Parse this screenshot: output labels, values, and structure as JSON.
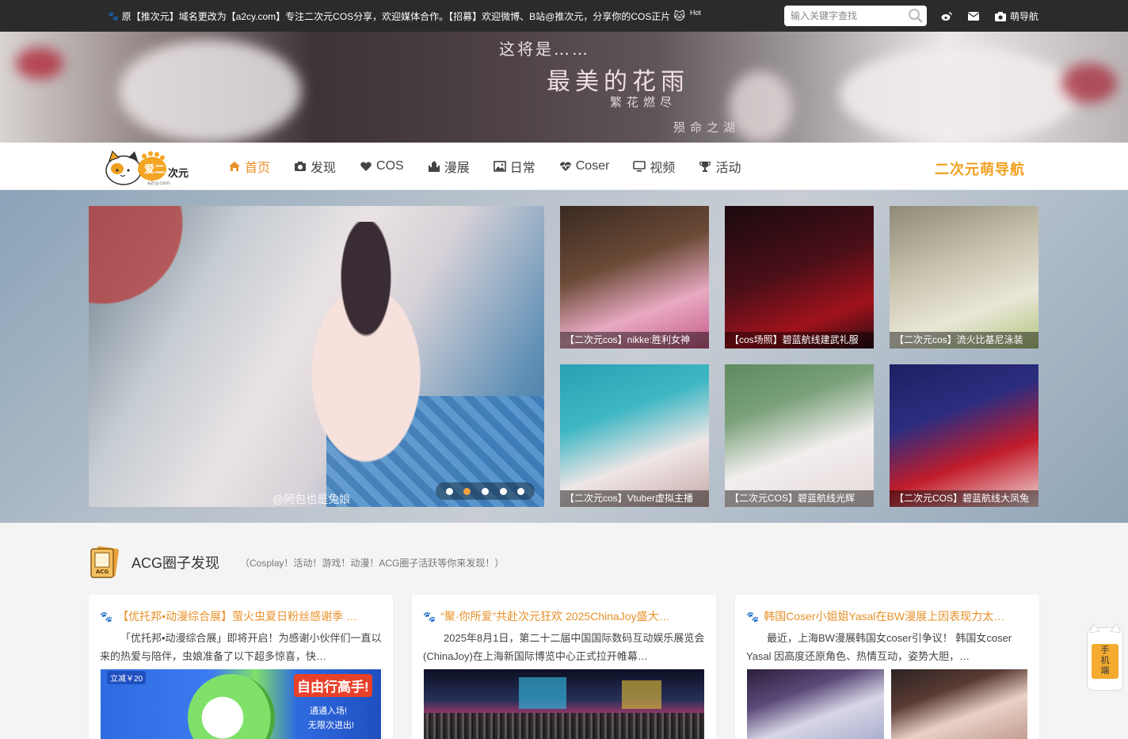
{
  "topbar": {
    "notice": "原【推次元】域名更改为【a2cy.com】专注二次元COS分享，欢迎媒体合作。【招募】欢迎微博、B站@推次元，分享你的COS正片",
    "hot_badge": "Hot",
    "search_placeholder": "输入关键字查找",
    "nav_link": "萌导航",
    "icons": [
      "weibo-icon",
      "mail-icon",
      "camera-icon"
    ]
  },
  "banner": {
    "line1": "这将是……",
    "line2": "最美的花雨",
    "line3": "繁花燃尽",
    "line4": "殒命之湖"
  },
  "nav": {
    "logo_text": "爱二次元",
    "items": [
      {
        "label": "首页",
        "icon": "home-icon",
        "active": true
      },
      {
        "label": "发现",
        "icon": "camera-icon",
        "active": false
      },
      {
        "label": "COS",
        "icon": "heart-icon",
        "active": false
      },
      {
        "label": "漫展",
        "icon": "castle-icon",
        "active": false
      },
      {
        "label": "日常",
        "icon": "image-icon",
        "active": false
      },
      {
        "label": "Coser",
        "icon": "heartbeat-icon",
        "active": false
      },
      {
        "label": "视频",
        "icon": "monitor-icon",
        "active": false
      },
      {
        "label": "活动",
        "icon": "trophy-icon",
        "active": false
      }
    ],
    "right_link": "二次元萌导航"
  },
  "slider": {
    "watermark": "@阿包也是兔娘",
    "dots": 5,
    "active_dot": 1
  },
  "thumbs": [
    {
      "caption": "【二次元cos】nikke:胜利女神",
      "colors": [
        "#3a2a22",
        "#e8a9c2"
      ]
    },
    {
      "caption": "【cos场照】碧蓝航线建武礼服",
      "colors": [
        "#2a0d12",
        "#a0121c"
      ]
    },
    {
      "caption": "【二次元cos】流火比基尼泳装",
      "colors": [
        "#c9c2ad",
        "#e9e6d8"
      ]
    },
    {
      "caption": "【二次元cos】Vtuber虚拟主播",
      "colors": [
        "#3fb7c4",
        "#efe6e6"
      ]
    },
    {
      "caption": "【二次元COS】碧蓝航线光辉",
      "colors": [
        "#7aa17a",
        "#f2eeee"
      ]
    },
    {
      "caption": "【二次元COS】碧蓝航线大凤兔",
      "colors": [
        "#1f1f63",
        "#c11c2a"
      ]
    }
  ],
  "section": {
    "title": "ACG圈子发现",
    "subtitle": "（Cosplay！活动！游戏！动漫！ACG圈子活跃等你来发现！）",
    "icon_label": "ACG"
  },
  "cards": [
    {
      "title": "【优托邦•动漫综合展】萤火虫夏日粉丝感谢季 …",
      "desc": "「优托邦•动漫综合展」即将开启！为感谢小伙伴们一直以来的热爱与陪伴，虫娘准备了以下超多惊喜，快…",
      "img_text_1": "立减￥20",
      "img_text_2": "自由行高手!",
      "img_text_3": "通通入场!",
      "img_text_4": "无限次进出!"
    },
    {
      "title": "“聚·你所爱”共赴次元狂欢 2025ChinaJoy盛大…",
      "desc": "2025年8月1日，第二十二届中国国际数码互动娱乐展览会(ChinaJoy)在上海新国际博览中心正式拉开帷幕…"
    },
    {
      "title": "韩国Coser小姐姐Yasal在BW漫展上因表现力太…",
      "desc": "最近，上海BW漫展韩国女coser引争议！ 韩国女coser Yasal 因高度还原角色、热情互动，姿势大胆，…"
    }
  ],
  "mobile_badge": {
    "line1": "手",
    "line2": "机",
    "line3": "端"
  },
  "colors": {
    "accent": "#e8912a",
    "topbar": "#2b2b2b",
    "nav_right": "#f0a020"
  }
}
